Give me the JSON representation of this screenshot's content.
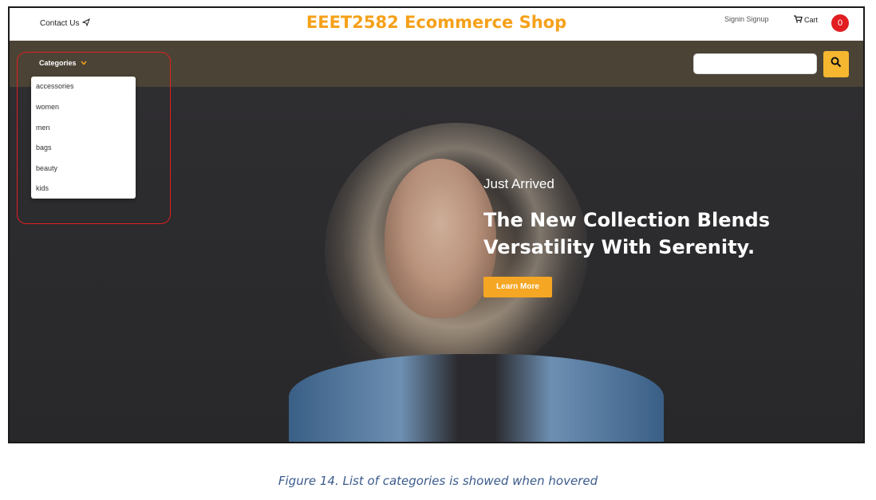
{
  "header": {
    "contact_label": "Contact Us",
    "title": "EEET2582 Ecommerce Shop",
    "auth_label": "Signin Signup",
    "cart_label": "Cart",
    "cart_count": "0"
  },
  "nav": {
    "categories_label": "Categories",
    "search_placeholder": ""
  },
  "dropdown": {
    "items": [
      "accessories",
      "women",
      "men",
      "bags",
      "beauty",
      "kids"
    ]
  },
  "hero": {
    "kicker": "Just Arrived",
    "headline_line1": "The New Collection Blends",
    "headline_line2": "Versatility With Serenity.",
    "cta_label": "Learn More"
  },
  "caption": "Figure 14. List of categories is showed when hovered",
  "colors": {
    "accent": "#f5a11a",
    "nav_bg": "#4b4335",
    "badge": "#e11d22",
    "highlight": "#e02020"
  }
}
